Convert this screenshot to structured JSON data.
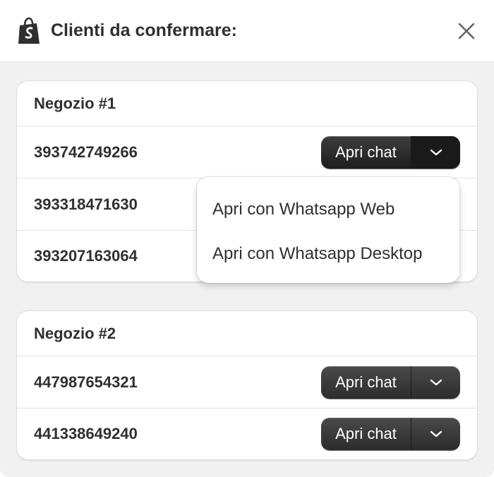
{
  "header": {
    "title": "Clienti da confermare:",
    "logo_icon": "shopify-bag-icon",
    "close_icon": "close-icon"
  },
  "stores": [
    {
      "name": "Negozio #1",
      "customers": [
        {
          "phone": "393742749266",
          "action_label": "Apri chat",
          "has_button": true
        },
        {
          "phone": "393318471630",
          "has_button": false
        },
        {
          "phone": "393207163064",
          "has_button": false
        }
      ]
    },
    {
      "name": "Negozio #2",
      "customers": [
        {
          "phone": "447987654321",
          "action_label": "Apri chat",
          "has_button": true
        },
        {
          "phone": "441338649240",
          "action_label": "Apri chat",
          "has_button": true
        }
      ]
    }
  ],
  "dropdown": {
    "items": [
      "Apri con Whatsapp Web",
      "Apri con Whatsapp Desktop"
    ]
  },
  "colors": {
    "brand": "#95bf47",
    "button_dark": "#303030",
    "text": "#303030",
    "panel_bg": "#f1f1f1"
  }
}
